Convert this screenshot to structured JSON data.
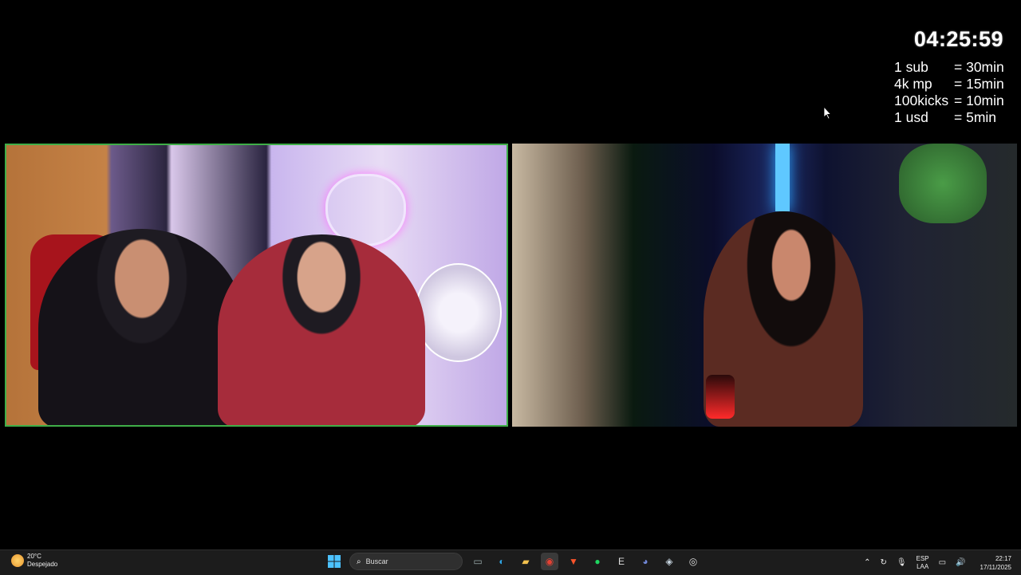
{
  "overlay": {
    "timer": "04:25:59",
    "rates": [
      {
        "key": "1 sub",
        "value": "= 30min"
      },
      {
        "key": "4k mp",
        "value": "= 15min"
      },
      {
        "key": "100kicks",
        "value": "= 10min"
      },
      {
        "key": "1 usd",
        "value": "= 5min"
      }
    ]
  },
  "colors": {
    "left_cam_border": "#3fae48",
    "taskbar_bg": "#1c1c1c"
  },
  "taskbar": {
    "weather": {
      "temp": "20°C",
      "condition": "Despejado",
      "icon": "weather-sun-icon"
    },
    "start_icon": "windows-start-icon",
    "search": {
      "placeholder": "Buscar"
    },
    "apps": [
      {
        "name": "task-view",
        "icon": "task-view-icon",
        "glyph": "▭",
        "color": "#9aa"
      },
      {
        "name": "edge",
        "icon": "edge-icon",
        "glyph": "◐",
        "color": "#2fa6e6"
      },
      {
        "name": "file-explorer",
        "icon": "folder-icon",
        "glyph": "▰",
        "color": "#f2c14e"
      },
      {
        "name": "chrome",
        "icon": "chrome-icon",
        "glyph": "◉",
        "color": "#e34133",
        "active": true
      },
      {
        "name": "brave",
        "icon": "brave-icon",
        "glyph": "▼",
        "color": "#fb542b"
      },
      {
        "name": "spotify",
        "icon": "spotify-icon",
        "glyph": "●",
        "color": "#1ed760"
      },
      {
        "name": "epic-games",
        "icon": "epic-games-icon",
        "glyph": "E",
        "color": "#ddd"
      },
      {
        "name": "discord",
        "icon": "discord-icon",
        "glyph": "◕",
        "color": "#7289da"
      },
      {
        "name": "steam",
        "icon": "steam-icon",
        "glyph": "◈",
        "color": "#c7d5e0"
      },
      {
        "name": "obs",
        "icon": "obs-icon",
        "glyph": "◎",
        "color": "#ddd"
      }
    ],
    "tray": {
      "language_top": "ESP",
      "language_bottom": "LAA",
      "time": "22:17",
      "date": "17/11/2025"
    }
  }
}
